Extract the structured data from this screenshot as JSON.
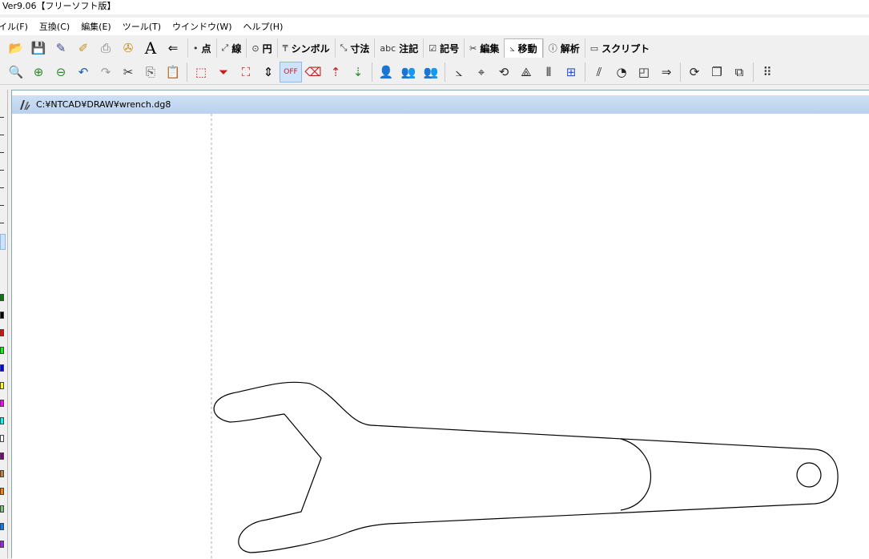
{
  "app": {
    "title": "Ver9.06【フリーソフト版】"
  },
  "menu": [
    {
      "label": "イル(F)"
    },
    {
      "label": "互換(C)"
    },
    {
      "label": "編集(E)"
    },
    {
      "label": "ツール(T)"
    },
    {
      "label": "ウインドウ(W)"
    },
    {
      "label": "ヘルプ(H)"
    }
  ],
  "toolbar_top": {
    "icons": [
      "open-folder-icon",
      "save-icon",
      "save-as-icon",
      "properties-icon",
      "print-icon",
      "settings-icon",
      "text-icon",
      "back-arrow-icon"
    ],
    "tabs": [
      {
        "label": "点",
        "icon": "•"
      },
      {
        "label": "線",
        "icon": "⤢"
      },
      {
        "label": "円",
        "icon": "⊙"
      },
      {
        "label": "シンボル",
        "icon": "₸"
      },
      {
        "label": "寸法",
        "icon": "⤡"
      },
      {
        "label": "注記",
        "icon": "abc"
      },
      {
        "label": "記号",
        "icon": "☑"
      },
      {
        "label": "編集",
        "icon": "✂"
      },
      {
        "label": "移動",
        "icon": "⦣"
      },
      {
        "label": "解析",
        "icon": "ⓘ"
      },
      {
        "label": "スクリプト",
        "icon": "▭"
      }
    ],
    "active_tab": "移動"
  },
  "document": {
    "path": "C:¥NTCAD¥DRAW¥wrench.dg8"
  },
  "drawing": {
    "object": "wrench",
    "guide_line": "dashed-vertical"
  },
  "colors": {
    "title_gradient_top": "#cfe0f4",
    "title_gradient_bottom": "#b9d1ee",
    "active_tool": "#cde3fb",
    "swatches": [
      "#008000",
      "#000000",
      "#ff0000",
      "#00ff00",
      "#0000ff",
      "#ffff00",
      "#ff00ff",
      "#00ffff",
      "#ffffff",
      "#800080",
      "#c08040",
      "#ff8000",
      "#80c080",
      "#0080ff",
      "#a020f0"
    ]
  }
}
